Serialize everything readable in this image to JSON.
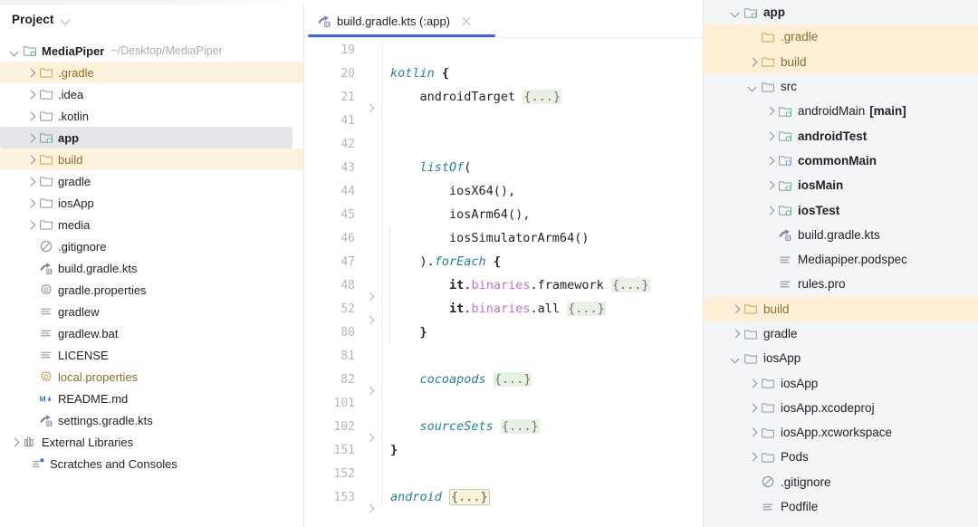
{
  "project_panel": {
    "header": {
      "title": "Project",
      "chevron_icon": "chevron-down-icon"
    },
    "root": {
      "label": "MediaPiper",
      "path": "~/Desktop/MediaPiper",
      "icon": "module-folder-icon"
    },
    "items": [
      {
        "label": ".gradle",
        "icon": "folder-icon",
        "arrow": "right",
        "indent": 2,
        "state": "amber",
        "bold": false
      },
      {
        "label": ".idea",
        "icon": "folder-icon",
        "arrow": "right",
        "indent": 2,
        "state": "normal",
        "bold": false
      },
      {
        "label": ".kotlin",
        "icon": "folder-icon",
        "arrow": "right",
        "indent": 2,
        "state": "normal",
        "bold": false
      },
      {
        "label": "app",
        "icon": "module-folder-icon",
        "arrow": "right",
        "indent": 2,
        "state": "selected",
        "bold": true
      },
      {
        "label": "build",
        "icon": "folder-icon",
        "arrow": "right",
        "indent": 2,
        "state": "amber",
        "bold": false
      },
      {
        "label": "gradle",
        "icon": "folder-icon",
        "arrow": "right",
        "indent": 2,
        "state": "normal",
        "bold": false
      },
      {
        "label": "iosApp",
        "icon": "folder-icon",
        "arrow": "right",
        "indent": 2,
        "state": "normal",
        "bold": false
      },
      {
        "label": "media",
        "icon": "folder-icon",
        "arrow": "right",
        "indent": 2,
        "state": "normal",
        "bold": false
      },
      {
        "label": ".gitignore",
        "icon": "ignored-file-icon",
        "arrow": "none",
        "indent": 2,
        "state": "normal",
        "bold": false
      },
      {
        "label": "build.gradle.kts",
        "icon": "gradle-kts-icon",
        "arrow": "none",
        "indent": 2,
        "state": "normal",
        "bold": false
      },
      {
        "label": "gradle.properties",
        "icon": "properties-icon",
        "arrow": "none",
        "indent": 2,
        "state": "normal",
        "bold": false
      },
      {
        "label": "gradlew",
        "icon": "text-file-icon",
        "arrow": "none",
        "indent": 2,
        "state": "normal",
        "bold": false
      },
      {
        "label": "gradlew.bat",
        "icon": "text-file-icon",
        "arrow": "none",
        "indent": 2,
        "state": "normal",
        "bold": false
      },
      {
        "label": "LICENSE",
        "icon": "text-file-icon",
        "arrow": "none",
        "indent": 2,
        "state": "normal",
        "bold": false
      },
      {
        "label": "local.properties",
        "icon": "properties-icon",
        "arrow": "none",
        "indent": 2,
        "state": "amber-text",
        "bold": false
      },
      {
        "label": "README.md",
        "icon": "markdown-icon",
        "arrow": "none",
        "indent": 2,
        "state": "normal",
        "bold": false
      },
      {
        "label": "settings.gradle.kts",
        "icon": "gradle-kts-icon",
        "arrow": "none",
        "indent": 2,
        "state": "normal",
        "bold": false
      },
      {
        "label": "External Libraries",
        "icon": "library-icon",
        "arrow": "right",
        "indent": 0,
        "state": "normal",
        "bold": false
      },
      {
        "label": "Scratches and Consoles",
        "icon": "scratches-icon",
        "arrow": "none",
        "indent": 1,
        "state": "normal",
        "bold": false
      }
    ]
  },
  "editor": {
    "tab": {
      "label": "build.gradle.kts (:app)",
      "icon": "gradle-kts-icon",
      "close_icon": "close-icon",
      "active": true,
      "accent_color": "#3b66e0"
    },
    "lines": [
      {
        "num": "19",
        "fold": false,
        "indent": 0,
        "tokens": []
      },
      {
        "num": "20",
        "fold": false,
        "indent": 0,
        "tokens": [
          {
            "t": "kotlin",
            "c": "kw"
          },
          {
            "t": " ",
            "c": ""
          },
          {
            "t": "{",
            "c": "bld"
          }
        ]
      },
      {
        "num": "21",
        "fold": true,
        "indent": 1,
        "tokens": [
          {
            "t": "    androidTarget ",
            "c": ""
          },
          {
            "t": "{...}",
            "c": "fold-green"
          }
        ]
      },
      {
        "num": "41",
        "fold": false,
        "indent": 0,
        "tokens": []
      },
      {
        "num": "42",
        "fold": false,
        "indent": 0,
        "tokens": []
      },
      {
        "num": "43",
        "fold": false,
        "indent": 0,
        "tokens": [
          {
            "t": "    ",
            "c": ""
          },
          {
            "t": "listOf",
            "c": "fn"
          },
          {
            "t": "(",
            "c": ""
          }
        ]
      },
      {
        "num": "44",
        "fold": false,
        "indent": 0,
        "tokens": [
          {
            "t": "        iosX64(),",
            "c": ""
          }
        ]
      },
      {
        "num": "45",
        "fold": false,
        "indent": 0,
        "tokens": [
          {
            "t": "        iosArm64(),",
            "c": ""
          }
        ]
      },
      {
        "num": "46",
        "fold": false,
        "indent": 0,
        "tokens": [
          {
            "t": "        iosSimulatorArm64()",
            "c": ""
          }
        ]
      },
      {
        "num": "47",
        "fold": false,
        "indent": 0,
        "tokens": [
          {
            "t": "    ).",
            "c": ""
          },
          {
            "t": "forEach",
            "c": "fn"
          },
          {
            "t": " ",
            "c": ""
          },
          {
            "t": "{",
            "c": "bld"
          }
        ]
      },
      {
        "num": "48",
        "fold": true,
        "indent": 0,
        "tokens": [
          {
            "t": "        ",
            "c": ""
          },
          {
            "t": "it",
            "c": "bld"
          },
          {
            "t": ".",
            "c": ""
          },
          {
            "t": "binaries",
            "c": "prop"
          },
          {
            "t": ".framework ",
            "c": ""
          },
          {
            "t": "{...}",
            "c": "fold-green"
          }
        ]
      },
      {
        "num": "52",
        "fold": true,
        "indent": 0,
        "tokens": [
          {
            "t": "        ",
            "c": ""
          },
          {
            "t": "it",
            "c": "bld"
          },
          {
            "t": ".",
            "c": ""
          },
          {
            "t": "binaries",
            "c": "prop"
          },
          {
            "t": ".all ",
            "c": ""
          },
          {
            "t": "{...}",
            "c": "fold-green"
          }
        ]
      },
      {
        "num": "80",
        "fold": false,
        "indent": 0,
        "tokens": [
          {
            "t": "    }",
            "c": "bld"
          }
        ]
      },
      {
        "num": "81",
        "fold": false,
        "indent": 0,
        "tokens": []
      },
      {
        "num": "82",
        "fold": true,
        "indent": 0,
        "tokens": [
          {
            "t": "    ",
            "c": ""
          },
          {
            "t": "cocoapods",
            "c": "kw"
          },
          {
            "t": " ",
            "c": ""
          },
          {
            "t": "{...}",
            "c": "fold-green"
          }
        ]
      },
      {
        "num": "101",
        "fold": false,
        "indent": 0,
        "tokens": []
      },
      {
        "num": "102",
        "fold": true,
        "indent": 0,
        "tokens": [
          {
            "t": "    ",
            "c": ""
          },
          {
            "t": "sourceSets",
            "c": "kw"
          },
          {
            "t": " ",
            "c": ""
          },
          {
            "t": "{...}",
            "c": "fold-green"
          }
        ]
      },
      {
        "num": "151",
        "fold": false,
        "indent": 0,
        "tokens": [
          {
            "t": "}",
            "c": "bld"
          }
        ]
      },
      {
        "num": "152",
        "fold": false,
        "indent": 0,
        "tokens": []
      },
      {
        "num": "153",
        "fold": true,
        "indent": 0,
        "tokens": [
          {
            "t": "android",
            "c": "kw"
          },
          {
            "t": " ",
            "c": ""
          },
          {
            "t": "{...}",
            "c": "fold-amber"
          }
        ]
      }
    ]
  },
  "right_panel": {
    "items": [
      {
        "label": "app",
        "icon": "module-folder-icon",
        "arrow": "down",
        "indent": 1,
        "state": "normal",
        "bold": true,
        "tag": ""
      },
      {
        "label": ".gradle",
        "icon": "folder-icon",
        "arrow": "none",
        "indent": 2,
        "state": "amber",
        "bold": false,
        "tag": ""
      },
      {
        "label": "build",
        "icon": "folder-icon",
        "arrow": "right",
        "indent": 2,
        "state": "amber",
        "bold": false,
        "tag": ""
      },
      {
        "label": "src",
        "icon": "folder-icon",
        "arrow": "down",
        "indent": 2,
        "state": "normal",
        "bold": false,
        "tag": ""
      },
      {
        "label": "androidMain",
        "icon": "module-folder-icon",
        "arrow": "right",
        "indent": 3,
        "state": "normal",
        "bold": false,
        "tag": "[main]"
      },
      {
        "label": "androidTest",
        "icon": "module-folder-icon",
        "arrow": "right",
        "indent": 3,
        "state": "normal",
        "bold": true,
        "tag": ""
      },
      {
        "label": "commonMain",
        "icon": "module-folder-icon",
        "arrow": "right",
        "indent": 3,
        "state": "normal",
        "bold": true,
        "tag": ""
      },
      {
        "label": "iosMain",
        "icon": "module-folder-icon",
        "arrow": "right",
        "indent": 3,
        "state": "normal",
        "bold": true,
        "tag": ""
      },
      {
        "label": "iosTest",
        "icon": "module-folder-icon",
        "arrow": "right",
        "indent": 3,
        "state": "normal",
        "bold": true,
        "tag": ""
      },
      {
        "label": "build.gradle.kts",
        "icon": "gradle-kts-icon",
        "arrow": "none",
        "indent": 3,
        "state": "normal",
        "bold": false,
        "tag": ""
      },
      {
        "label": "Mediapiper.podspec",
        "icon": "text-file-icon",
        "arrow": "none",
        "indent": 3,
        "state": "normal",
        "bold": false,
        "tag": ""
      },
      {
        "label": "rules.pro",
        "icon": "text-file-icon",
        "arrow": "none",
        "indent": 3,
        "state": "normal",
        "bold": false,
        "tag": ""
      },
      {
        "label": "build",
        "icon": "folder-icon",
        "arrow": "right",
        "indent": 1,
        "state": "amber",
        "bold": false,
        "tag": ""
      },
      {
        "label": "gradle",
        "icon": "folder-icon",
        "arrow": "right",
        "indent": 1,
        "state": "normal",
        "bold": false,
        "tag": ""
      },
      {
        "label": "iosApp",
        "icon": "folder-icon",
        "arrow": "down",
        "indent": 1,
        "state": "normal",
        "bold": false,
        "tag": ""
      },
      {
        "label": "iosApp",
        "icon": "folder-icon",
        "arrow": "right",
        "indent": 2,
        "state": "normal",
        "bold": false,
        "tag": ""
      },
      {
        "label": "iosApp.xcodeproj",
        "icon": "folder-icon",
        "arrow": "right",
        "indent": 2,
        "state": "normal",
        "bold": false,
        "tag": ""
      },
      {
        "label": "iosApp.xcworkspace",
        "icon": "folder-icon",
        "arrow": "right",
        "indent": 2,
        "state": "normal",
        "bold": false,
        "tag": ""
      },
      {
        "label": "Pods",
        "icon": "folder-icon",
        "arrow": "right",
        "indent": 2,
        "state": "normal",
        "bold": false,
        "tag": ""
      },
      {
        "label": ".gitignore",
        "icon": "ignored-file-icon",
        "arrow": "none",
        "indent": 2,
        "state": "normal",
        "bold": false,
        "tag": ""
      },
      {
        "label": "Podfile",
        "icon": "text-file-icon",
        "arrow": "none",
        "indent": 2,
        "state": "normal",
        "bold": false,
        "tag": ""
      }
    ]
  },
  "colors": {
    "accent": "#3b66e0",
    "amber_row": "#fdf3dd",
    "amber_text": "#8a6d2f",
    "selected_row": "#e3e5e8",
    "fold_green": "#e7f2e4",
    "fold_amber": "#fbf2d9",
    "keyword": "#2a7f94",
    "property": "#c06fd0",
    "right_panel_bg": "#f4f5f7"
  }
}
